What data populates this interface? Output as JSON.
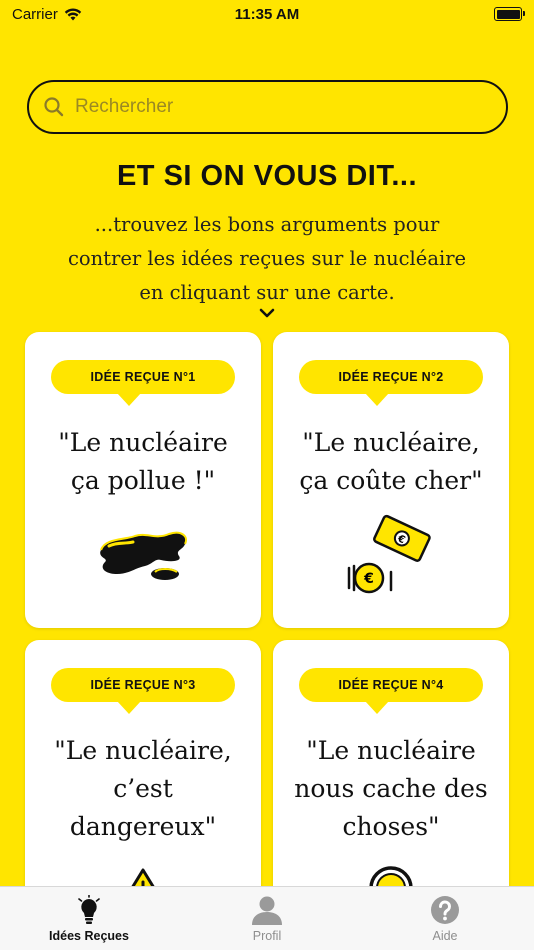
{
  "status_bar": {
    "carrier": "Carrier",
    "time": "11:35 AM"
  },
  "search": {
    "placeholder": "Rechercher"
  },
  "header": {
    "title": "ET SI ON VOUS DIT...",
    "subtitle": "...trouvez les bons arguments pour contrer les idées reçues sur le nucléaire en cliquant sur une carte."
  },
  "cards": [
    {
      "badge": "IDÉE REÇUE N°1",
      "quote": "\"Le nucléaire\nça pollue !\"",
      "icon": "oil-spill-icon"
    },
    {
      "badge": "IDÉE REÇUE N°2",
      "quote": "\"Le nucléaire,\nça coûte cher\"",
      "icon": "money-icon"
    },
    {
      "badge": "IDÉE REÇUE N°3",
      "quote": "\"Le nucléaire,\nc’est\ndangereux\"",
      "icon": "warning-icon"
    },
    {
      "badge": "IDÉE REÇUE N°4",
      "quote": "\"Le nucléaire\nnous cache des\nchoses\"",
      "icon": "lock-icon"
    }
  ],
  "tab_bar": {
    "tabs": [
      {
        "label": "Idées Reçues",
        "icon": "lightbulb-icon",
        "active": true
      },
      {
        "label": "Profil",
        "icon": "person-icon",
        "active": false
      },
      {
        "label": "Aide",
        "icon": "help-icon",
        "active": false
      }
    ]
  },
  "colors": {
    "background": "#FFE500",
    "card": "#FFFFFF",
    "text": "#111111"
  }
}
